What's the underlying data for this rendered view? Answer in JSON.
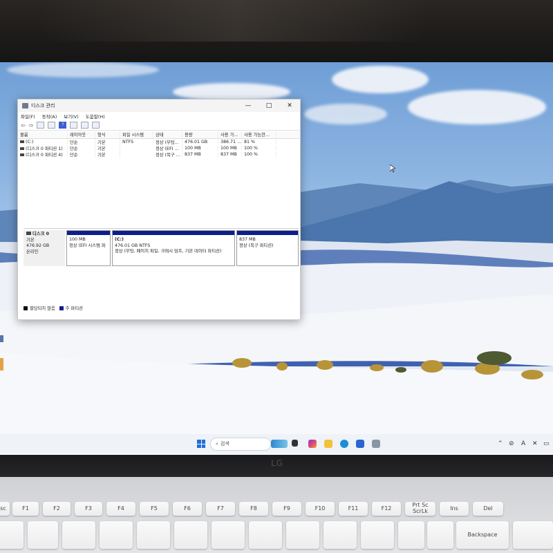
{
  "window": {
    "title": "디스크 관리",
    "controls": [
      "—",
      "□",
      "✕"
    ],
    "menu": [
      "파일(F)",
      "동작(A)",
      "보기(V)",
      "도움말(H)"
    ]
  },
  "volume_table": {
    "columns": [
      "볼륨",
      "레이아웃",
      "형식",
      "파일 시스템",
      "상태",
      "용량",
      "사용 가...",
      "사용 가능한..."
    ],
    "rows": [
      {
        "volume": "(C:)",
        "layout": "단순",
        "type": "기본",
        "fs": "NTFS",
        "status": "정상 (부팅...",
        "capacity": "476.01 GB",
        "free": "386.71 ...",
        "pct": "81 %"
      },
      {
        "volume": "(디스크 0 파티션 1)",
        "layout": "단순",
        "type": "기본",
        "fs": "",
        "status": "정상 (EFI ...",
        "capacity": "100 MB",
        "free": "100 MB",
        "pct": "100 %"
      },
      {
        "volume": "(디스크 0 파티션 4)",
        "layout": "단순",
        "type": "기본",
        "fs": "",
        "status": "정상 (복구 ...",
        "capacity": "837 MB",
        "free": "837 MB",
        "pct": "100 %"
      }
    ]
  },
  "disk": {
    "name": "디스크 0",
    "kind": "기본",
    "size": "476.92 GB",
    "state": "온라인",
    "partitions": [
      {
        "title": "",
        "size": "100 MB",
        "desc": "정상 (EFI 시스템 파"
      },
      {
        "title": "(C:)",
        "size": "476.01 GB NTFS",
        "desc": "정상 (부팅, 페이지 파일, 크래시 덤프, 기본 데이터 파티션)"
      },
      {
        "title": "",
        "size": "837 MB",
        "desc": "정상 (복구 파티션)"
      }
    ]
  },
  "legend": {
    "unallocated": "할당되지 않음",
    "primary": "주 파티션",
    "colors": {
      "unallocated": "#111111",
      "primary": "#0d1e8c"
    }
  },
  "taskbar": {
    "search_placeholder": "검색"
  },
  "device": {
    "logo": "LG",
    "keys": [
      "Esc",
      "F1",
      "F2",
      "F3",
      "F4",
      "F5",
      "F6",
      "F7",
      "F8",
      "F9",
      "F10",
      "F11",
      "F12",
      "Prt Sc ScrLk",
      "Ins",
      "Del",
      "Backspace"
    ]
  }
}
